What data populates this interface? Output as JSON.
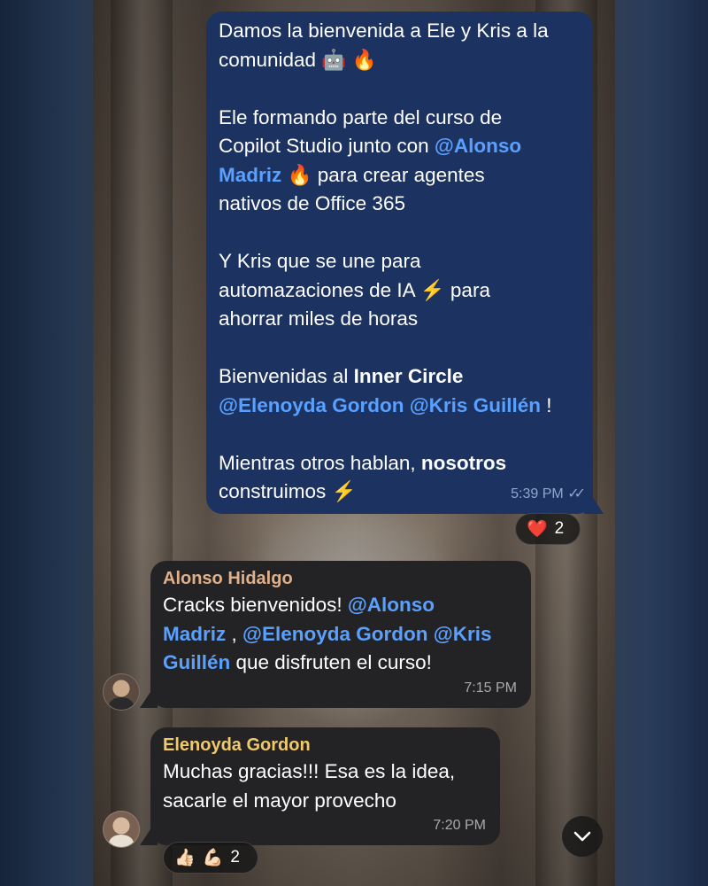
{
  "message_out": {
    "line1": "Damos la bienvenida a Ele y Kris a la",
    "line2": "comunidad",
    "emoji_robot": "🤖",
    "emoji_fire": "🔥",
    "para2_a": "Ele formando parte del curso de",
    "para2_b": "Copilot Studio junto con ",
    "mention_alonso": "@Alonso",
    "mention_madriz": "Madriz",
    "para2_c": " para crear agentes",
    "para2_d": "nativos de Office 365",
    "para3_a": "Y Kris que se une para",
    "para3_b": "automazaciones de IA ",
    "emoji_bolt": "⚡",
    "para3_c": " para",
    "para3_d": "ahorrar miles de horas",
    "para4_a": "Bienvenidas al ",
    "para4_bold": "Inner Circle",
    "mention_elenoyda": "@Elenoyda Gordon",
    "mention_kris": "@Kris Guillén",
    "para4_end": " !",
    "para5_a": "Mientras otros hablan, ",
    "para5_bold": "nosotros",
    "para5_b": "construimos ",
    "time": "5:39 PM",
    "read_ticks": "✓✓"
  },
  "reaction_out": {
    "emoji": "❤️",
    "count": "2"
  },
  "message_in1": {
    "sender": "Alonso Hidalgo",
    "sender_color": "#e0b08a",
    "text_a": "Cracks bienvenidos! ",
    "mention_alonso": "@Alonso",
    "mention_madriz": "Madriz",
    "text_b": " , ",
    "mention_elenoyda": "@Elenoyda Gordon",
    "mention_kris": "@Kris",
    "mention_guillen": "Guillén",
    "text_c": " que disfruten el curso!",
    "time": "7:15 PM"
  },
  "message_in2": {
    "sender": "Elenoyda Gordon",
    "sender_color": "#f2c96a",
    "line1": "Muchas gracias!!! Esa es la idea,",
    "line2": "sacarle el mayor provecho",
    "time": "7:20 PM"
  },
  "reaction_in2": {
    "emoji1": "👍🏻",
    "emoji2": "💪🏻",
    "count": "2"
  },
  "scroll_button": {
    "icon": "chevron-down-icon"
  }
}
